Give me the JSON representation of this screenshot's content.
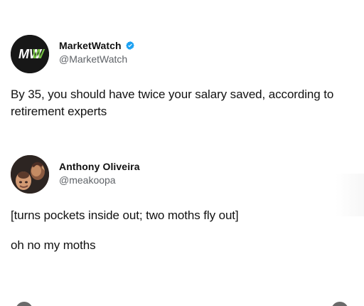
{
  "tweets": [
    {
      "display_name": "MarketWatch",
      "handle": "@MarketWatch",
      "verified": true,
      "avatar_icon": "marketwatch-logo-icon",
      "avatar_text": "MW",
      "text": "By 35, you should have twice your salary saved, according to retirement experts",
      "accent_color": "#1DA1F2"
    },
    {
      "display_name": "Anthony Oliveira",
      "handle": "@meakoopa",
      "verified": false,
      "avatar_icon": "user-photo-icon",
      "lines": [
        "[turns pockets inside out; two moths fly out]",
        "oh no my moths"
      ]
    }
  ]
}
